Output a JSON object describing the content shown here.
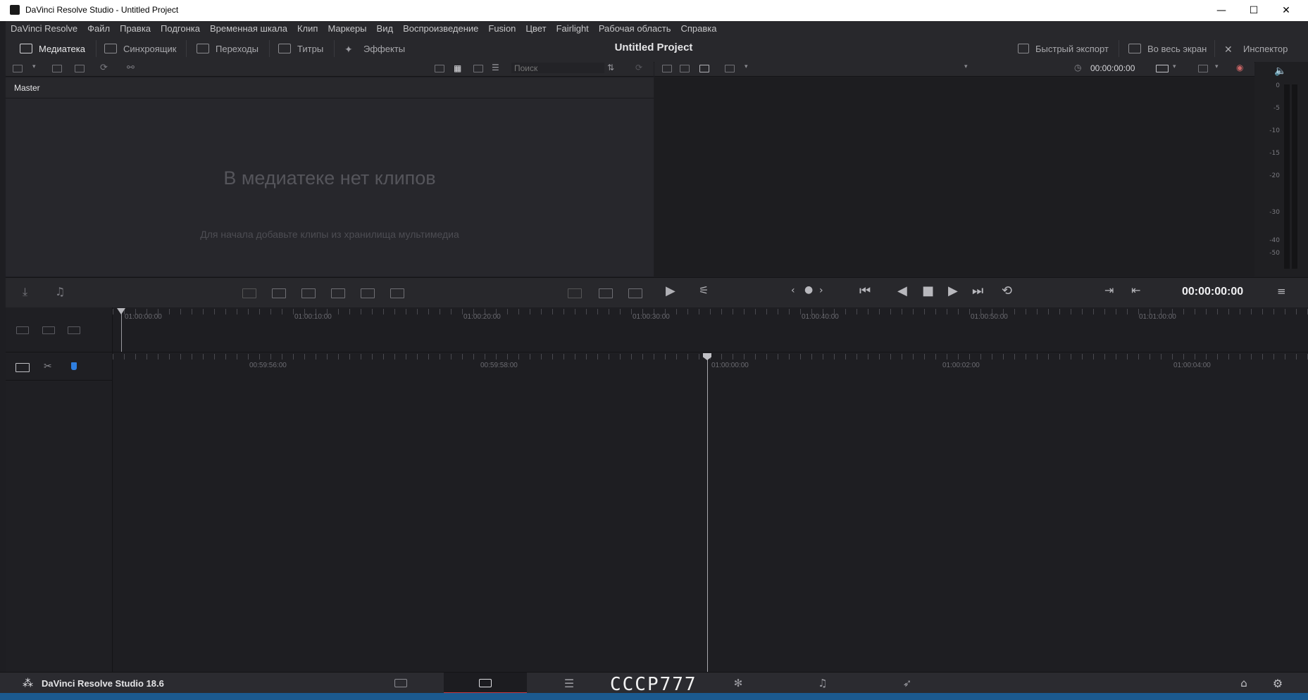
{
  "window": {
    "title": "DaVinci Resolve Studio - Untitled Project",
    "minimize": "—",
    "maximize": "☐",
    "close": "✕"
  },
  "menu": [
    "DaVinci Resolve",
    "Файл",
    "Правка",
    "Подгонка",
    "Временная шкала",
    "Клип",
    "Маркеры",
    "Вид",
    "Воспроизведение",
    "Fusion",
    "Цвет",
    "Fairlight",
    "Рабочая область",
    "Справка"
  ],
  "modules": {
    "media_pool": "Медиатека",
    "sync_bin": "Синхроящик",
    "transitions": "Переходы",
    "titles": "Титры",
    "effects": "Эффекты",
    "project_title": "Untitled Project",
    "quick_export": "Быстрый экспорт",
    "fullscreen": "Во весь экран",
    "inspector": "Инспектор"
  },
  "mediapool": {
    "search_placeholder": "Поиск",
    "bin": "Master",
    "empty_title": "В медиатеке нет клипов",
    "empty_hint": "Для начала добавьте клипы из хранилища мультимедиа"
  },
  "viewer": {
    "timecode_top": "00:00:00:00",
    "timecode_main": "00:00:00:00"
  },
  "meter": {
    "labels": [
      "0",
      "-5",
      "-10",
      "-15",
      "-20",
      "-30",
      "-40",
      "-50"
    ]
  },
  "ruler_upper": [
    "01:00:00:00",
    "01:00:10:00",
    "01:00:20:00",
    "01:00:30:00",
    "01:00:40:00",
    "01:00:50:00",
    "01:01:00:00"
  ],
  "ruler_lower": [
    "00:59:56:00",
    "00:59:58:00",
    "01:00:00:00",
    "01:00:02:00",
    "01:00:04:00"
  ],
  "footer": {
    "app_name": "DaVinci Resolve Studio 18.6",
    "watermark": "CCCP777"
  },
  "colors": {
    "accent_red": "#c8353a",
    "accent_blue": "#2f7fe0"
  }
}
